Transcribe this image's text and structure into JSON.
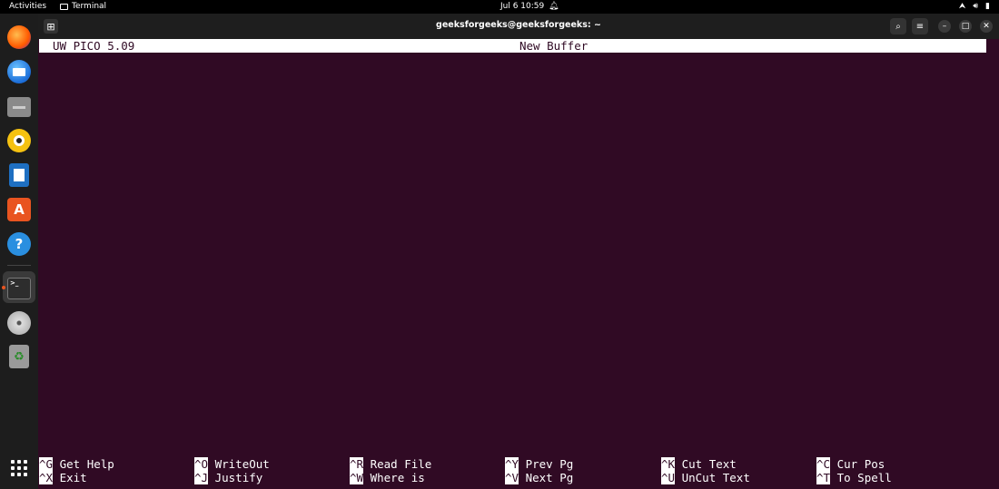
{
  "topbar": {
    "activities": "Activities",
    "app_name": "Terminal",
    "clock": "Jul 6  10:59"
  },
  "dock": {
    "items": [
      "firefox",
      "thunderbird",
      "files",
      "rhythmbox",
      "libreoffice-writer",
      "app-center",
      "help",
      "terminal",
      "dvd",
      "trash"
    ],
    "help_glyph": "?",
    "appstore_glyph": "A"
  },
  "window": {
    "title": "geeksforgeeks@geeksforgeeks: ~"
  },
  "pico": {
    "version": "UW PICO 5.09",
    "buffer": "New Buffer",
    "commands": [
      {
        "key": "^G",
        "label": "Get Help"
      },
      {
        "key": "^O",
        "label": "WriteOut"
      },
      {
        "key": "^R",
        "label": "Read File"
      },
      {
        "key": "^Y",
        "label": "Prev Pg"
      },
      {
        "key": "^K",
        "label": "Cut Text"
      },
      {
        "key": "^C",
        "label": "Cur Pos"
      },
      {
        "key": "^X",
        "label": "Exit"
      },
      {
        "key": "^J",
        "label": "Justify"
      },
      {
        "key": "^W",
        "label": "Where is"
      },
      {
        "key": "^V",
        "label": "Next Pg"
      },
      {
        "key": "^U",
        "label": "UnCut Text"
      },
      {
        "key": "^T",
        "label": "To Spell"
      }
    ]
  },
  "colors": {
    "terminal_bg": "#300a24",
    "accent": "#e95420"
  }
}
